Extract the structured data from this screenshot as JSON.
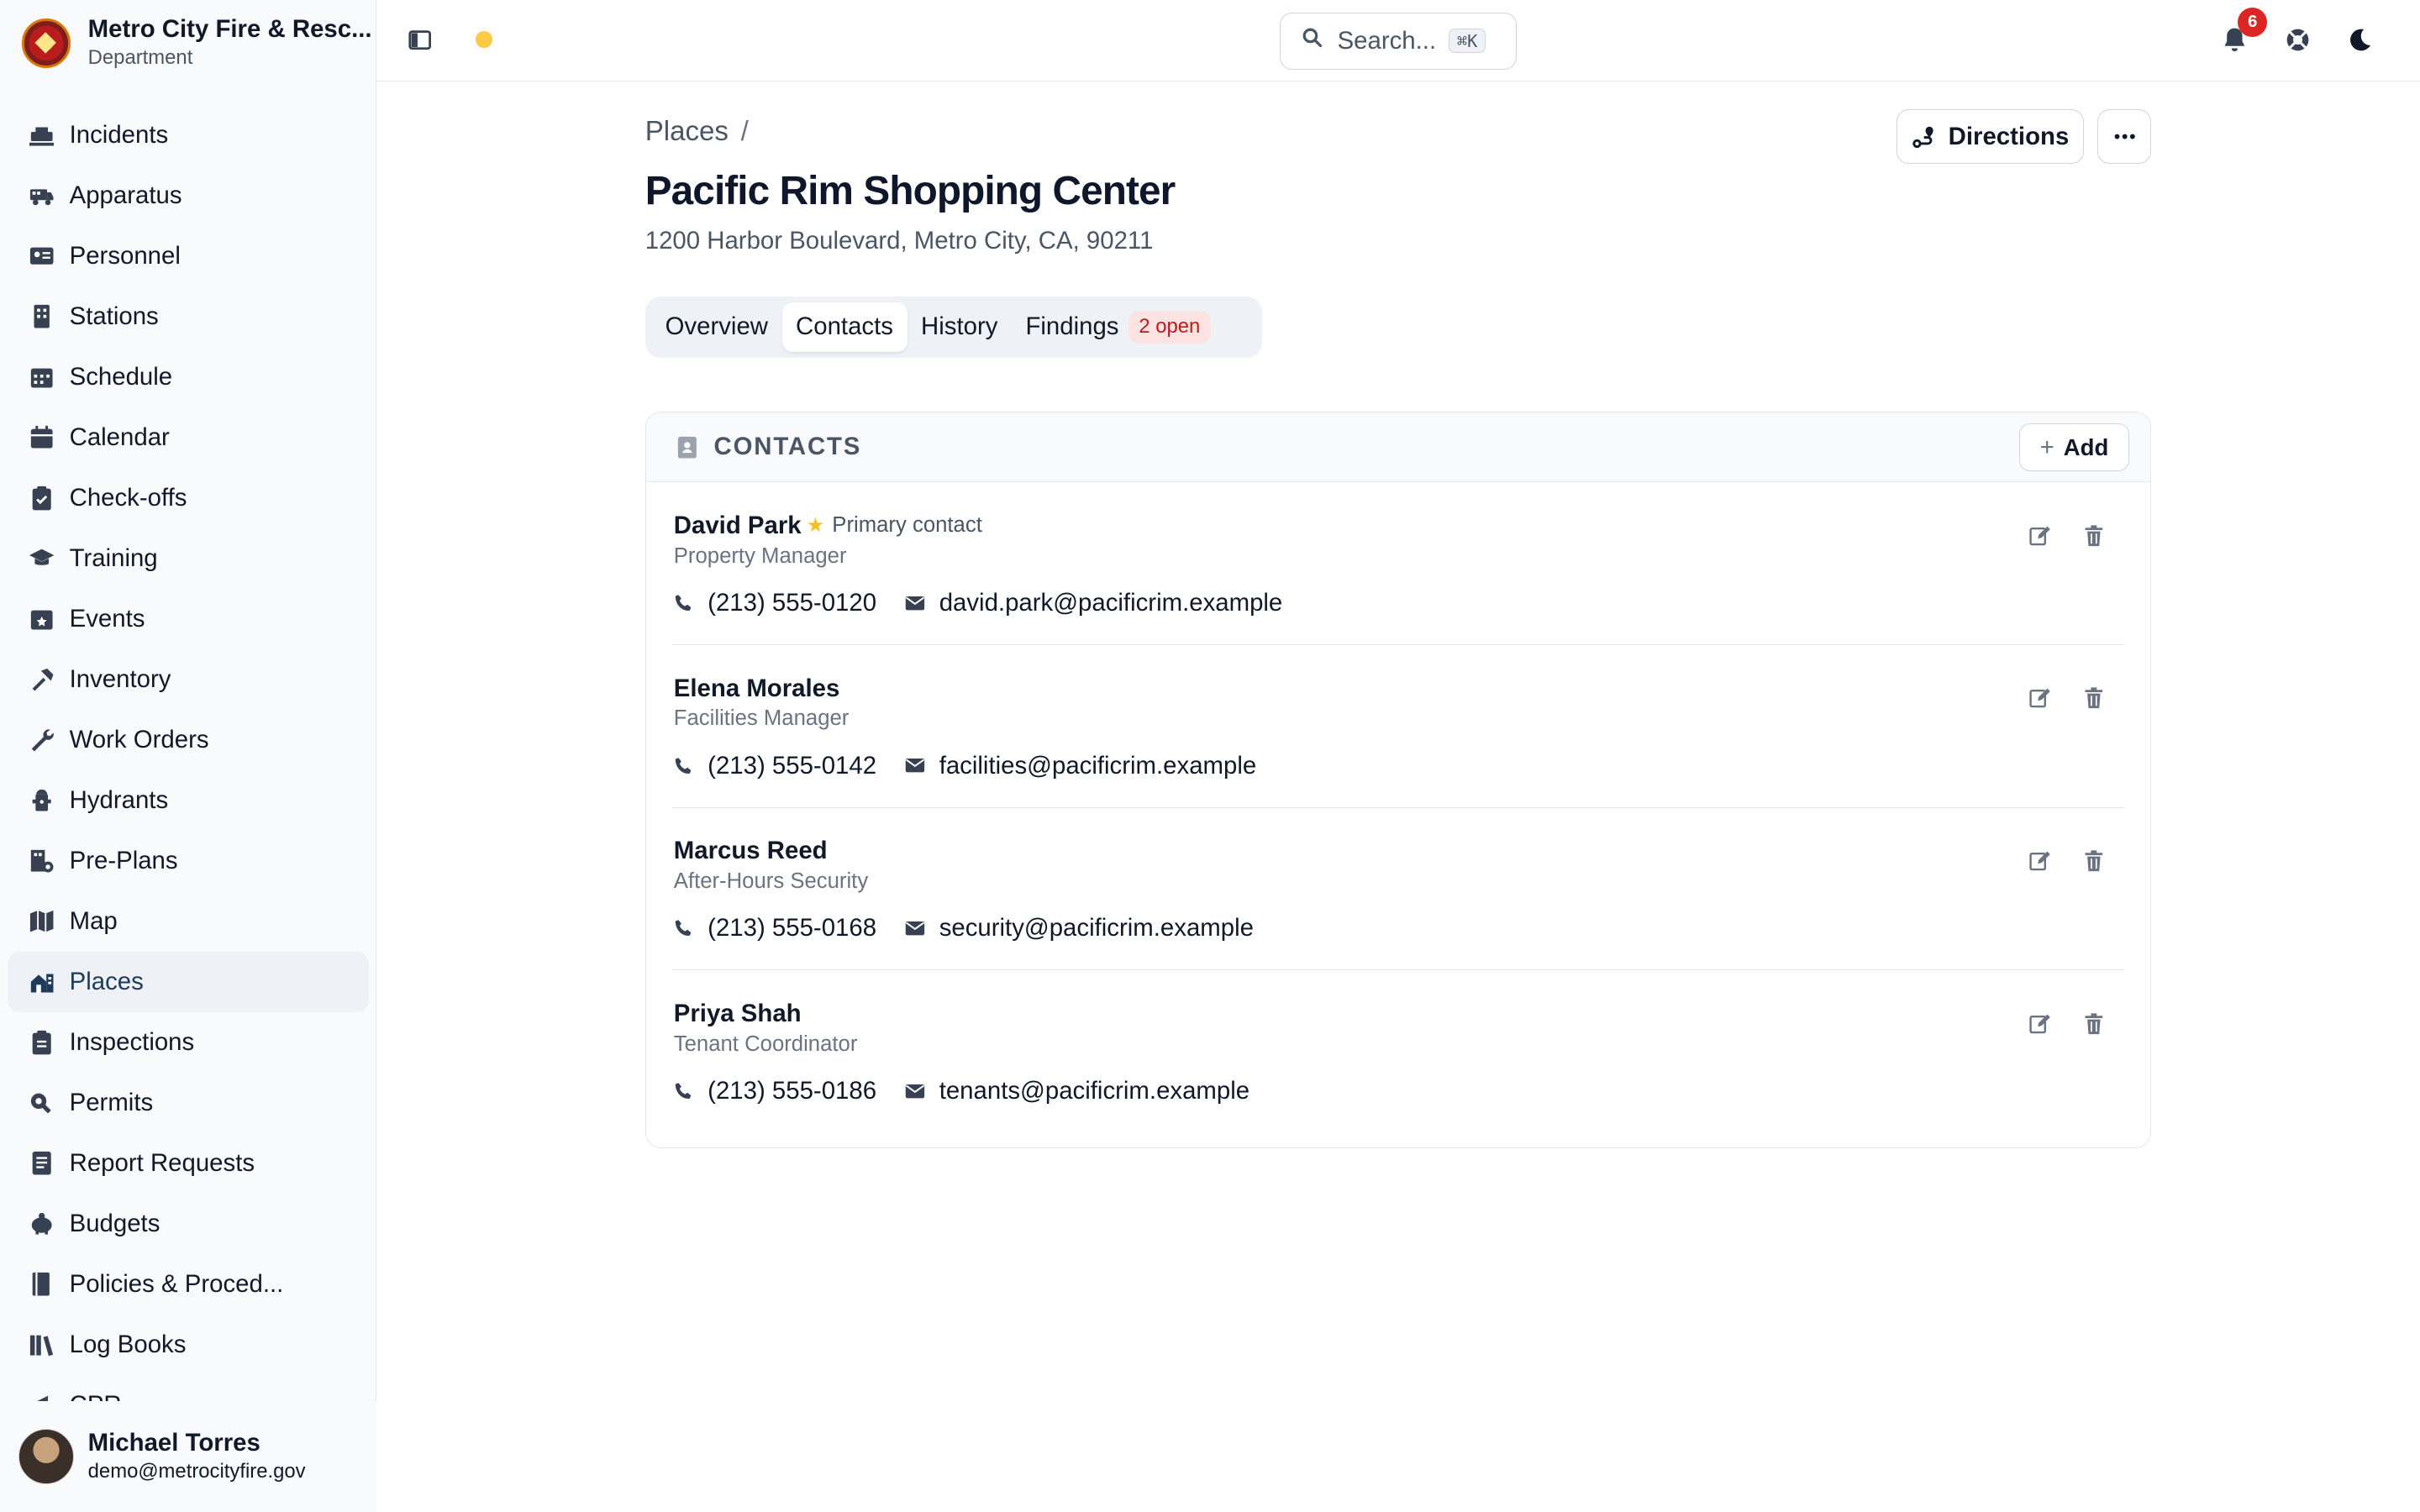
{
  "org": {
    "name": "Metro City Fire & Resc...",
    "subtitle": "Department"
  },
  "sidebar": {
    "items": [
      {
        "label": "Incidents",
        "icon": "incidents-icon"
      },
      {
        "label": "Apparatus",
        "icon": "fire-truck-icon"
      },
      {
        "label": "Personnel",
        "icon": "id-card-icon"
      },
      {
        "label": "Stations",
        "icon": "building-icon"
      },
      {
        "label": "Schedule",
        "icon": "calendar-grid-icon"
      },
      {
        "label": "Calendar",
        "icon": "calendar-icon"
      },
      {
        "label": "Check-offs",
        "icon": "clipboard-check-icon"
      },
      {
        "label": "Training",
        "icon": "graduation-cap-icon"
      },
      {
        "label": "Events",
        "icon": "calendar-star-icon"
      },
      {
        "label": "Inventory",
        "icon": "hammer-icon"
      },
      {
        "label": "Work Orders",
        "icon": "wrench-icon"
      },
      {
        "label": "Hydrants",
        "icon": "hydrant-icon"
      },
      {
        "label": "Pre-Plans",
        "icon": "building-plan-icon"
      },
      {
        "label": "Map",
        "icon": "map-icon"
      },
      {
        "label": "Places",
        "icon": "places-icon"
      },
      {
        "label": "Inspections",
        "icon": "clipboard-list-icon"
      },
      {
        "label": "Permits",
        "icon": "permit-icon"
      },
      {
        "label": "Report Requests",
        "icon": "report-icon"
      },
      {
        "label": "Budgets",
        "icon": "piggy-bank-icon"
      },
      {
        "label": "Policies & Proced...",
        "icon": "book-icon"
      },
      {
        "label": "Log Books",
        "icon": "books-icon"
      },
      {
        "label": "CPR",
        "icon": "megaphone-icon"
      }
    ],
    "active_index": 14
  },
  "user": {
    "name": "Michael Torres",
    "email": "demo@metrocityfire.gov"
  },
  "topbar": {
    "search_placeholder": "Search...",
    "search_shortcut": "⌘K",
    "notification_count": "6"
  },
  "page": {
    "breadcrumb": "Places",
    "breadcrumb_sep": "/",
    "title": "Pacific Rim Shopping Center",
    "address": "1200 Harbor Boulevard, Metro City, CA, 90211",
    "directions_label": "Directions",
    "more_label": "···"
  },
  "tabs": [
    {
      "label": "Overview"
    },
    {
      "label": "Contacts"
    },
    {
      "label": "History"
    },
    {
      "label": "Findings"
    }
  ],
  "findings_badge": "2 open",
  "contacts_card": {
    "title": "CONTACTS",
    "add_label": "Add"
  },
  "contacts": [
    {
      "name": "David Park",
      "primary_label": "Primary contact",
      "role": "Property Manager",
      "phone": "(213) 555-0120",
      "email": "david.park@pacificrim.example"
    },
    {
      "name": "Elena Morales",
      "role": "Facilities Manager",
      "phone": "(213) 555-0142",
      "email": "facilities@pacificrim.example"
    },
    {
      "name": "Marcus Reed",
      "role": "After-Hours Security",
      "phone": "(213) 555-0168",
      "email": "security@pacificrim.example"
    },
    {
      "name": "Priya Shah",
      "role": "Tenant Coordinator",
      "phone": "(213) 555-0186",
      "email": "tenants@pacificrim.example"
    }
  ],
  "colors": {
    "accent": "#1f3b5a",
    "badge_red": "#dc2626",
    "findings_pill_bg": "#fde2e2",
    "findings_pill_fg": "#b91c1c",
    "star": "#fbbf24"
  }
}
